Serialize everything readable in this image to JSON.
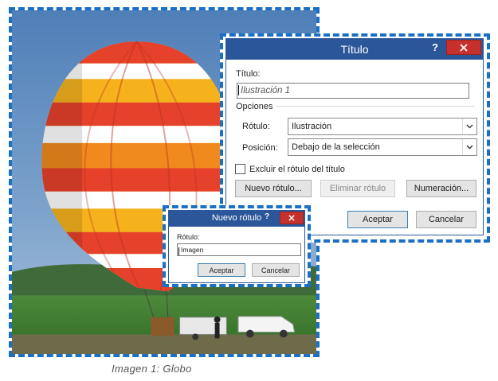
{
  "caption": "Imagen  1: Globo",
  "title_dialog": {
    "title": "Título",
    "help": "?",
    "title_label": "Título:",
    "title_value": "Ilustración 1",
    "options_label": "Opciones",
    "caption_label": "Rótulo:",
    "caption_value": "Ilustración",
    "position_label": "Posición:",
    "position_value": "Debajo de la selección",
    "exclude_label": "Excluir el rótulo del título",
    "exclude_checked": false,
    "new_caption_button": "Nuevo rótulo...",
    "delete_caption_button": "Eliminar rótulo",
    "numbering_button": "Numeración...",
    "ok_button": "Aceptar",
    "cancel_button": "Cancelar"
  },
  "new_caption_dialog": {
    "title": "Nuevo rótulo",
    "help": "?",
    "caption_label": "Rótulo:",
    "caption_value": "Imagen",
    "ok_button": "Aceptar",
    "cancel_button": "Cancelar"
  },
  "colors": {
    "accent_dash": "#1b6fc4",
    "titlebar": "#2b579a",
    "close": "#c7312b"
  }
}
